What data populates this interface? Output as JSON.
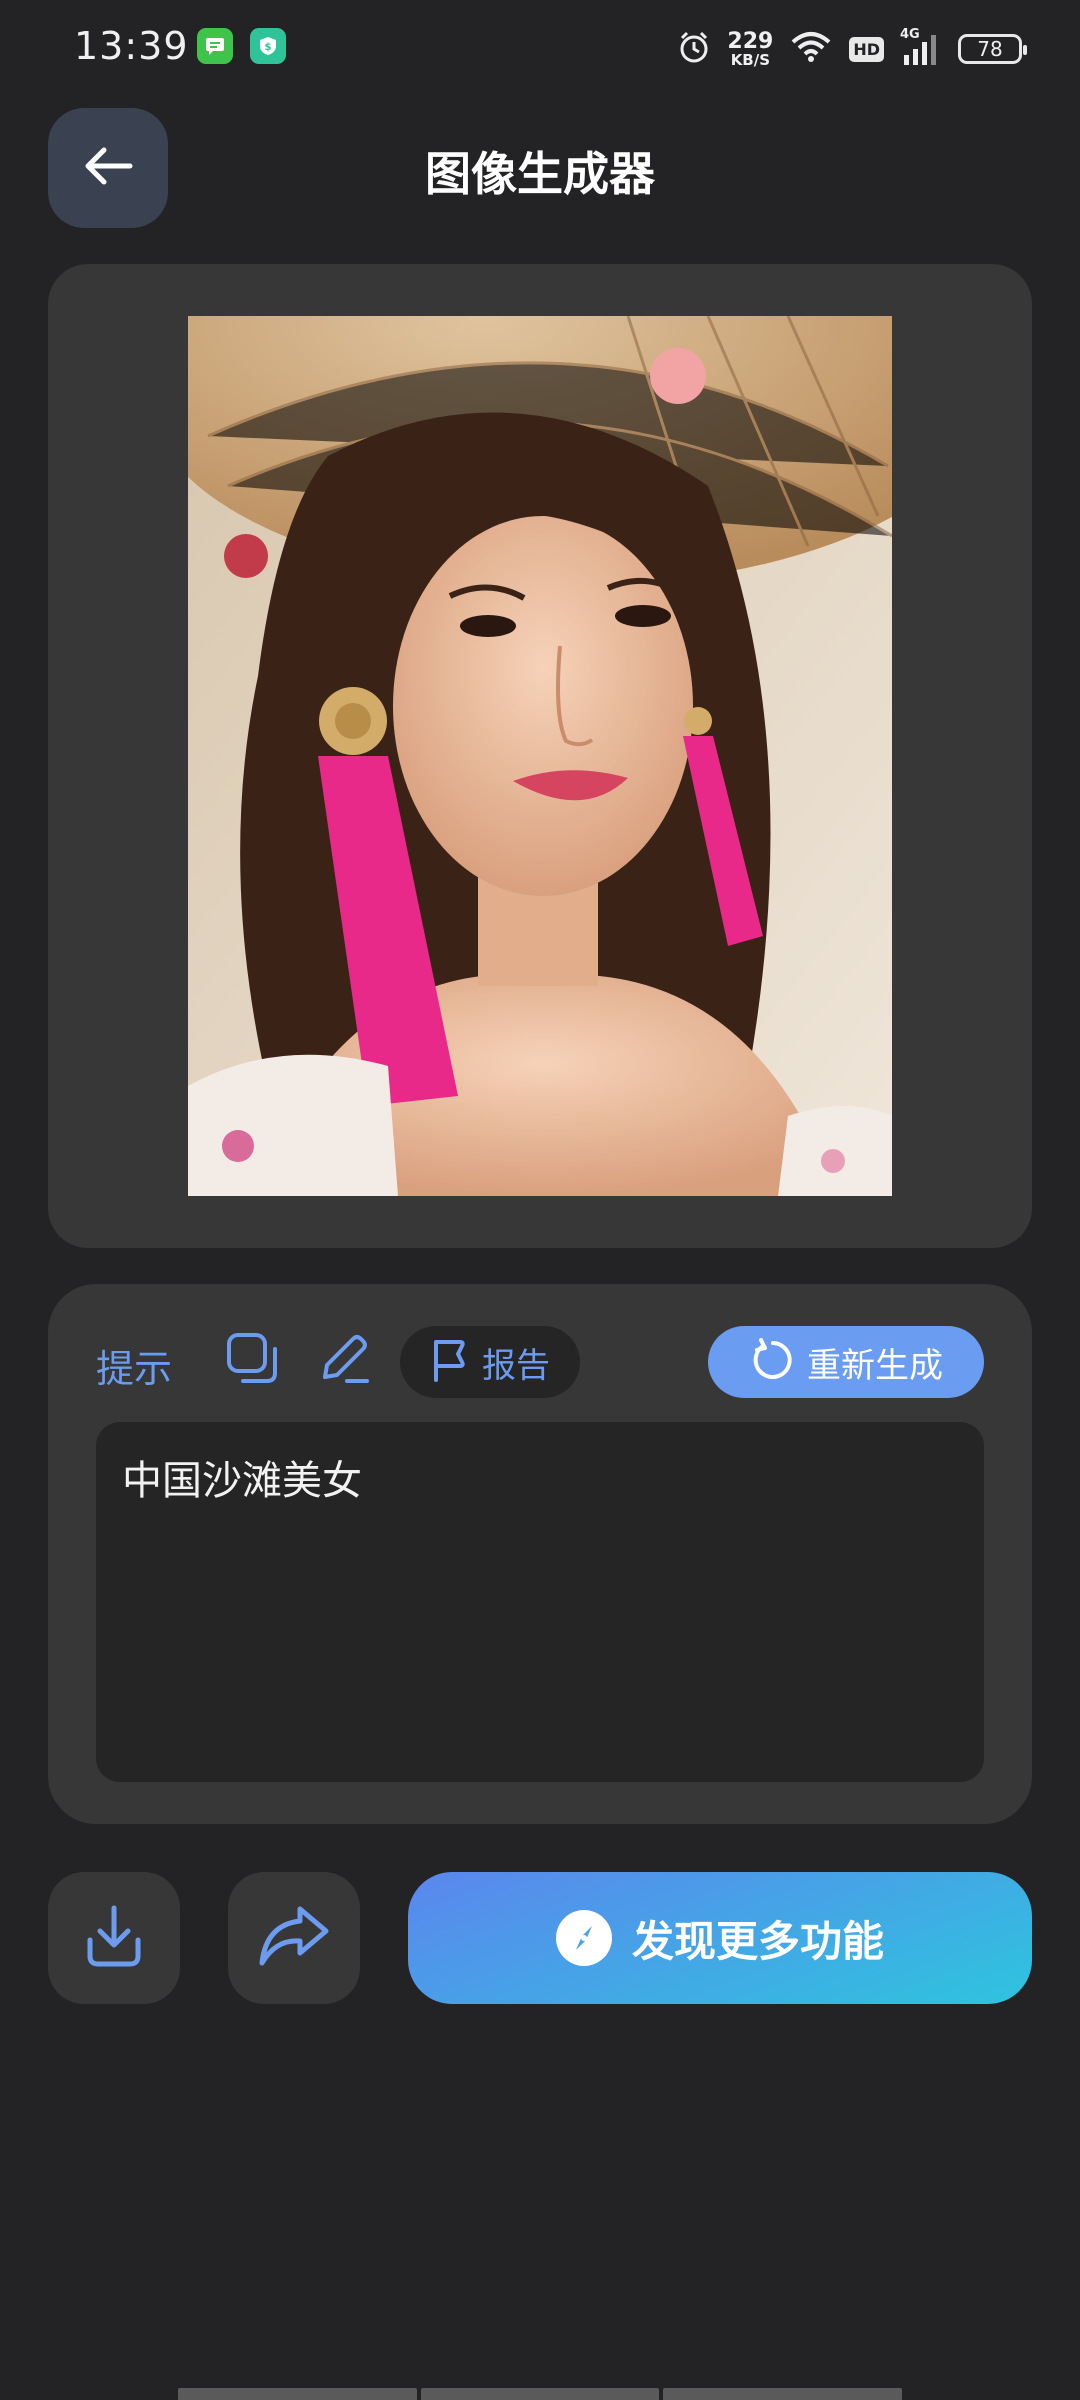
{
  "status_bar": {
    "time": "13:39",
    "net_speed_value": "229",
    "net_speed_unit": "KB/S",
    "hd": "HD",
    "network": "4G",
    "battery": "78",
    "notification_icons": [
      "message-icon",
      "payment-icon"
    ]
  },
  "header": {
    "title": "图像生成器",
    "back_icon": "arrow-left-icon"
  },
  "image_card": {
    "image": "generated-portrait-image"
  },
  "prompt_card": {
    "label": "提示",
    "report_label": "报告",
    "regenerate_label": "重新生成",
    "prompt_text": "中国沙滩美女"
  },
  "actions": {
    "download_icon": "download-icon",
    "share_icon": "share-icon",
    "discover_label": "发现更多功能"
  },
  "colors": {
    "background": "#232224",
    "card": "#373737",
    "accent_blue": "#6b9cf0",
    "gradient_start": "#5b86ee",
    "gradient_end": "#2ec4de"
  }
}
